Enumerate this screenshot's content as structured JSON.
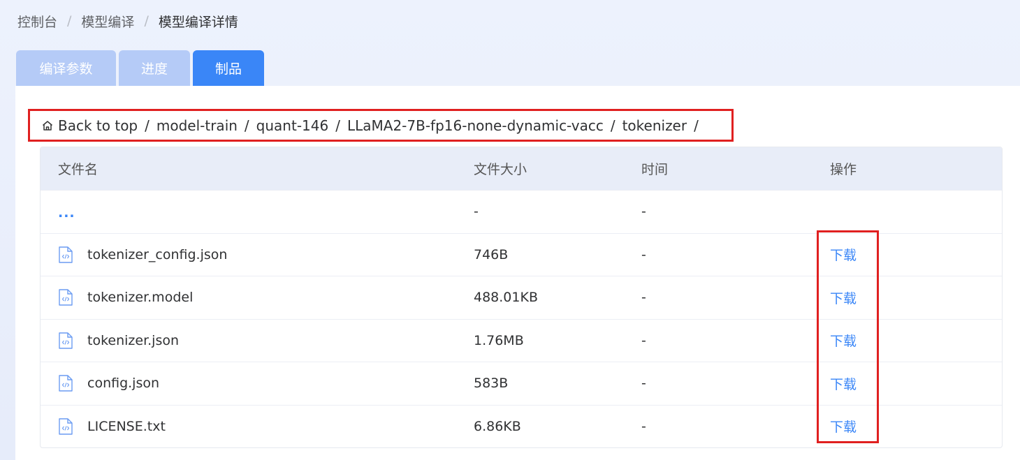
{
  "breadcrumb": [
    "控制台",
    "模型编译",
    "模型编译详情"
  ],
  "tabs": [
    {
      "label": "编译参数",
      "active": false
    },
    {
      "label": "进度",
      "active": false
    },
    {
      "label": "制品",
      "active": true
    }
  ],
  "path": {
    "root": "Back to top",
    "segments": [
      "model-train",
      "quant-146",
      "LLaMA2-7B-fp16-none-dynamic-vacc",
      "tokenizer"
    ],
    "separator": "/"
  },
  "table": {
    "headers": {
      "name": "文件名",
      "size": "文件大小",
      "time": "时间",
      "op": "操作"
    },
    "parent_row": {
      "name": "...",
      "size": "-",
      "time": "-"
    },
    "rows": [
      {
        "name": "tokenizer_config.json",
        "size": "746B",
        "time": "-",
        "op": "下载"
      },
      {
        "name": "tokenizer.model",
        "size": "488.01KB",
        "time": "-",
        "op": "下载"
      },
      {
        "name": "tokenizer.json",
        "size": "1.76MB",
        "time": "-",
        "op": "下载"
      },
      {
        "name": "config.json",
        "size": "583B",
        "time": "-",
        "op": "下载"
      },
      {
        "name": "LICENSE.txt",
        "size": "6.86KB",
        "time": "-",
        "op": "下载"
      }
    ]
  },
  "colors": {
    "accent": "#3a86f7",
    "tab_inactive": "#b5cbf7",
    "highlight": "#e02020"
  }
}
